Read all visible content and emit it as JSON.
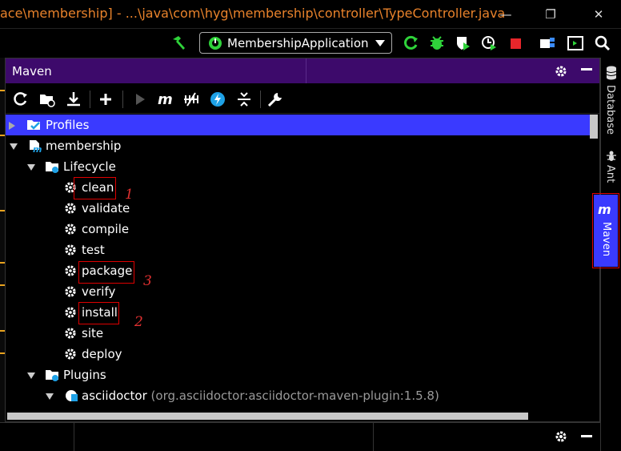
{
  "window": {
    "title": "ace\\membership] - ...\\java\\com\\hyg\\membership\\controller\\TypeController.java",
    "controls": {
      "minimize": "—",
      "restore": "❐",
      "close": "✕"
    }
  },
  "toolbar": {
    "run_config": "MembershipApplication"
  },
  "maven": {
    "title": "Maven",
    "tree": [
      {
        "label": "Profiles"
      },
      {
        "label": "membership"
      },
      {
        "label": "Lifecycle"
      },
      {
        "label": "clean"
      },
      {
        "label": "validate"
      },
      {
        "label": "compile"
      },
      {
        "label": "test"
      },
      {
        "label": "package"
      },
      {
        "label": "verify"
      },
      {
        "label": "install"
      },
      {
        "label": "site"
      },
      {
        "label": "deploy"
      },
      {
        "label": "Plugins"
      },
      {
        "label": "asciidoctor",
        "sub": "(org.asciidoctor:asciidoctor-maven-plugin:1.5.8)"
      }
    ]
  },
  "annotations": {
    "a1": "1",
    "a2": "2",
    "a3": "3"
  },
  "side_tabs": {
    "database": "Database",
    "ant": "Ant",
    "maven": "Maven"
  },
  "colors": {
    "accent_title": "#e8822b",
    "header_bg": "#3d0a6b",
    "selection": "#3a3aff",
    "run_green": "#2fd33a"
  }
}
